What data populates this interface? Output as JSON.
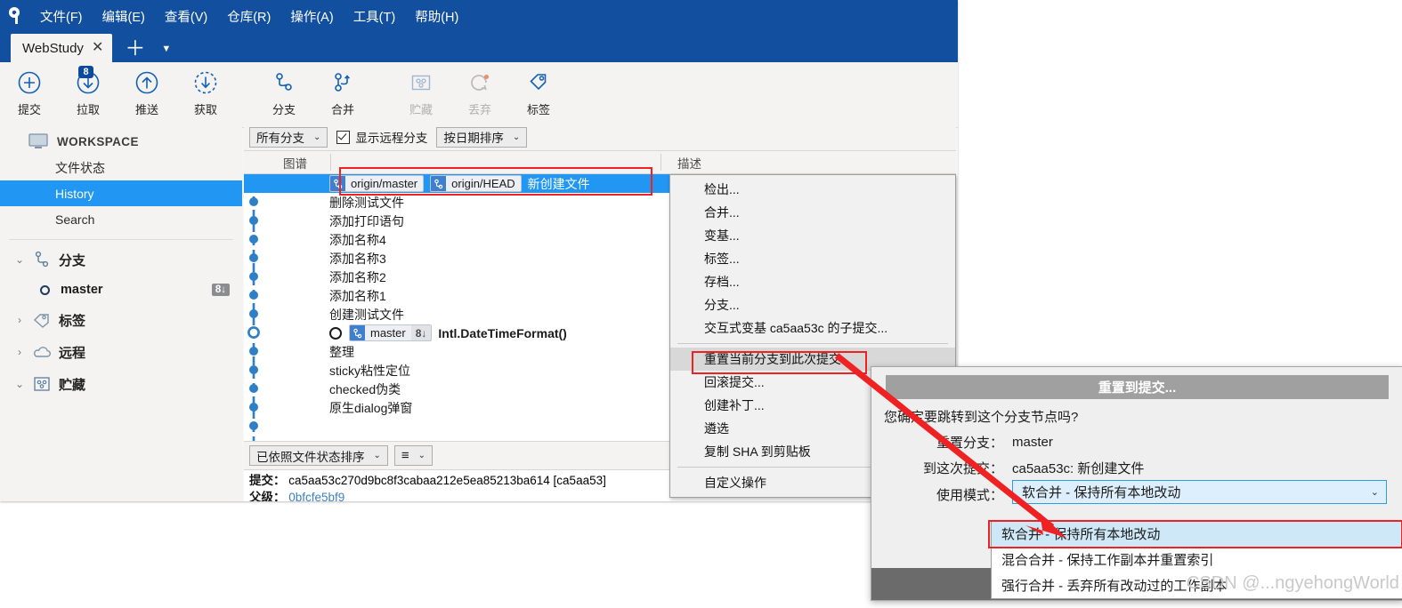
{
  "app": {
    "title": "WebStudy",
    "menu": [
      "文件(F)",
      "编辑(E)",
      "查看(V)",
      "仓库(R)",
      "操作(A)",
      "工具(T)",
      "帮助(H)"
    ],
    "tab_close_glyph": "✕",
    "tab_add_glyph": "＋",
    "tab_caret_glyph": "▼"
  },
  "toolbar": {
    "buttons": [
      {
        "label": "提交",
        "icon": "plus-circle-icon",
        "badge": "",
        "disabled": false
      },
      {
        "label": "拉取",
        "icon": "arrow-down-circle-icon",
        "badge": "8",
        "disabled": false
      },
      {
        "label": "推送",
        "icon": "arrow-up-circle-icon",
        "badge": "",
        "disabled": false
      },
      {
        "label": "获取",
        "icon": "fetch-dashed-circle-icon",
        "badge": "",
        "disabled": false
      },
      {
        "label": "分支",
        "icon": "branch-icon",
        "badge": "",
        "disabled": false
      },
      {
        "label": "合并",
        "icon": "merge-icon",
        "badge": "",
        "disabled": false
      },
      {
        "label": "贮藏",
        "icon": "stash-icon",
        "badge": "",
        "disabled": true
      },
      {
        "label": "丢弃",
        "icon": "discard-refresh-icon",
        "badge": "",
        "disabled": true
      },
      {
        "label": "标签",
        "icon": "tag-icon",
        "badge": "",
        "disabled": false
      }
    ]
  },
  "sidebar": {
    "workspace_label": "WORKSPACE",
    "workspace_icon": "monitor-icon",
    "items": [
      {
        "label": "文件状态",
        "active": false
      },
      {
        "label": "History",
        "active": true
      },
      {
        "label": "Search",
        "active": false
      }
    ],
    "groups": [
      {
        "label": "分支",
        "icon": "branch-icon",
        "expanded": true,
        "chevron": "⌄"
      },
      {
        "label": "标签",
        "icon": "tag-icon",
        "expanded": false,
        "chevron": "›"
      },
      {
        "label": "远程",
        "icon": "cloud-icon",
        "expanded": false,
        "chevron": "›"
      },
      {
        "label": "贮藏",
        "icon": "stash-icon",
        "expanded": true,
        "chevron": "⌄"
      }
    ],
    "branch": {
      "name": "master",
      "badge": "8↓",
      "icon": "commit-dot-icon"
    }
  },
  "filterbar": {
    "branch_filter": "所有分支",
    "show_remote_label": "显示远程分支",
    "show_remote_checked": true,
    "sort_by": "按日期排序",
    "caret_glyph": "⌄"
  },
  "columns": {
    "graph": "图谱",
    "description": "描述"
  },
  "commits": [
    {
      "message": "新创建文件",
      "selected": true,
      "bold": false,
      "head": false,
      "refs": [
        {
          "name": "origin/master",
          "count": ""
        },
        {
          "name": "origin/HEAD",
          "count": ""
        }
      ]
    },
    {
      "message": "删除测试文件",
      "selected": false,
      "bold": false,
      "head": false,
      "refs": []
    },
    {
      "message": "添加打印语句",
      "selected": false,
      "bold": false,
      "head": false,
      "refs": []
    },
    {
      "message": "添加名称4",
      "selected": false,
      "bold": false,
      "head": false,
      "refs": []
    },
    {
      "message": "添加名称3",
      "selected": false,
      "bold": false,
      "head": false,
      "refs": []
    },
    {
      "message": "添加名称2",
      "selected": false,
      "bold": false,
      "head": false,
      "refs": []
    },
    {
      "message": "添加名称1",
      "selected": false,
      "bold": false,
      "head": false,
      "refs": []
    },
    {
      "message": "创建测试文件",
      "selected": false,
      "bold": false,
      "head": false,
      "refs": []
    },
    {
      "message": "Intl.DateTimeFormat()",
      "selected": false,
      "bold": true,
      "head": true,
      "refs": [
        {
          "name": "master",
          "count": "8↓"
        }
      ]
    },
    {
      "message": "整理",
      "selected": false,
      "bold": false,
      "head": false,
      "refs": []
    },
    {
      "message": "sticky粘性定位",
      "selected": false,
      "bold": false,
      "head": false,
      "refs": []
    },
    {
      "message": "checked伪类",
      "selected": false,
      "bold": false,
      "head": false,
      "refs": []
    },
    {
      "message": "原生dialog弹窗",
      "selected": false,
      "bold": false,
      "head": false,
      "refs": []
    }
  ],
  "bottombar": {
    "sort_label": "已依照文件状态排序",
    "list_glyph": "≡",
    "caret_glyph": "⌄"
  },
  "details": {
    "commit_label": "提交：",
    "commit_sha": "ca5aa53c270d9bc8f3cabaa212e5ea85213ba614 [ca5aa53]",
    "parent_label": "父级：",
    "parent_sha": "0bfcfe5bf9"
  },
  "context_menu": {
    "items": [
      {
        "label": "检出...",
        "highlight": false,
        "sep_after": false
      },
      {
        "label": "合并...",
        "highlight": false,
        "sep_after": false
      },
      {
        "label": "变基...",
        "highlight": false,
        "sep_after": false
      },
      {
        "label": "标签...",
        "highlight": false,
        "sep_after": false
      },
      {
        "label": "存档...",
        "highlight": false,
        "sep_after": false
      },
      {
        "label": "分支...",
        "highlight": false,
        "sep_after": false
      },
      {
        "label": "交互式变基 ca5aa53c 的子提交...",
        "highlight": false,
        "sep_after": true
      },
      {
        "label": "重置当前分支到此次提交",
        "highlight": true,
        "sep_after": false
      },
      {
        "label": "回滚提交...",
        "highlight": false,
        "sep_after": false
      },
      {
        "label": "创建补丁...",
        "highlight": false,
        "sep_after": false
      },
      {
        "label": "遴选",
        "highlight": false,
        "sep_after": false
      },
      {
        "label": "复制 SHA 到剪贴板",
        "highlight": false,
        "sep_after": true
      },
      {
        "label": "自定义操作",
        "highlight": false,
        "sep_after": false
      }
    ]
  },
  "dialog": {
    "title": "重置到提交...",
    "question": "您确定要跳转到这个分支节点吗?",
    "reset_branch_label": "重置分支：",
    "reset_branch_value": "master",
    "to_commit_label": "到这次提交：",
    "to_commit_value": "ca5aa53c: 新创建文件",
    "mode_label": "使用模式：",
    "mode_value": "软合并 - 保持所有本地改动",
    "caret_glyph": "⌄",
    "options": [
      {
        "label": "软合并 - 保持所有本地改动",
        "selected": true
      },
      {
        "label": "混合合并 - 保持工作副本并重置索引",
        "selected": false
      },
      {
        "label": "强行合并 - 丢弃所有改动过的工作副本",
        "selected": false
      }
    ]
  },
  "watermark": "CSDN @...ngyehongWorld",
  "colors": {
    "title_blue": "#12509f",
    "accent_blue": "#2196f3",
    "graph_blue": "#2e7fc6",
    "annotation_red": "#ee2222",
    "dialog_gray": "#a0a0a0"
  }
}
